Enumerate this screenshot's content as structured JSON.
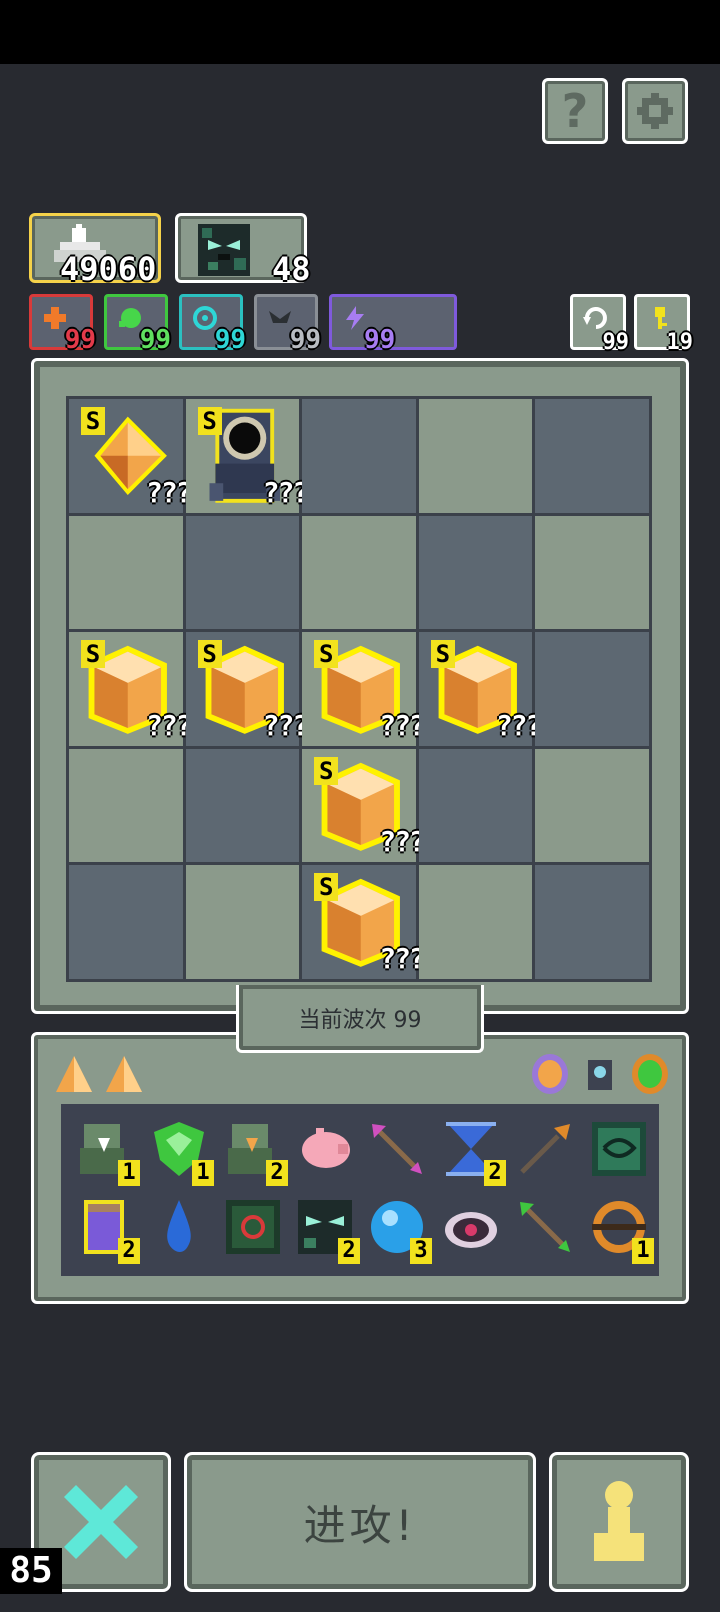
{
  "header": {
    "help_label": "?",
    "settings_icon": "gear-icon"
  },
  "resources": {
    "coins": "49060",
    "monster_count": "48"
  },
  "stats": [
    {
      "name": "attack",
      "value": "99",
      "color": "#d83a3a",
      "icon": "cross-icon"
    },
    {
      "name": "poison",
      "value": "99",
      "color": "#3fc73f",
      "icon": "slime-icon"
    },
    {
      "name": "spiral",
      "value": "99",
      "color": "#2bc0c0",
      "icon": "spiral-icon"
    },
    {
      "name": "wings",
      "value": "99",
      "color": "#8a8f96",
      "icon": "wings-icon"
    },
    {
      "name": "lightning",
      "value": "99",
      "color": "#7f5adc",
      "icon": "bolt-icon"
    }
  ],
  "right_counters": {
    "refresh": "99",
    "keys": "19"
  },
  "board": {
    "rank_label": "S",
    "unknown_label": "???"
  },
  "wave_label": "当前波次 99",
  "inventory": {
    "counts": [
      "1",
      "1",
      "2",
      "2",
      "2",
      "2",
      "3",
      "1"
    ]
  },
  "bottom": {
    "attack_label": "进攻!",
    "fps": "85"
  }
}
